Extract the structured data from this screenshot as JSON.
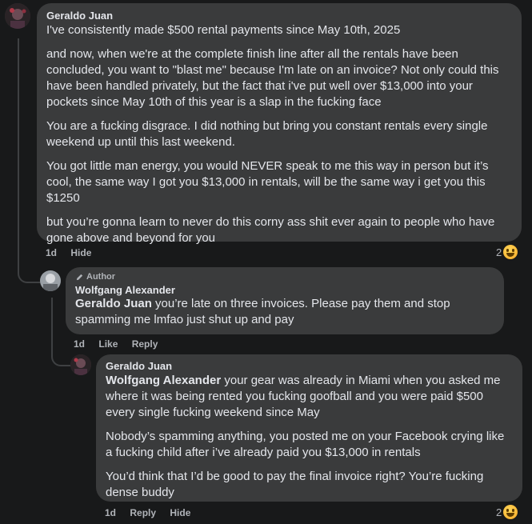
{
  "comment1": {
    "author": "Geraldo Juan",
    "paragraphs": [
      "I've consistently made $500 rental payments since May 10th, 2025",
      "and now, when we're at the complete finish line after all the rentals have been concluded, you want to \"blast me\" because I'm late on an invoice? Not only could this have been handled privately, but the fact that i've put well over $13,000 into your pockets since May 10th of this year is a slap in the fucking face",
      "You are a fucking disgrace. I did nothing but bring you constant rentals every single weekend up until this last weekend.",
      "You got little man energy, you would NEVER speak to me this way in person but it’s cool, the same way I got you $13,000 in rentals, will be the same way i get you this $1250",
      "but you’re gonna learn to never do this corny ass shit ever again to people who have gone above and beyond for you"
    ],
    "time": "1d",
    "hide_label": "Hide",
    "reaction_count": "2",
    "reaction_icon": "laughing-emoji-icon"
  },
  "reply1": {
    "badge": "Author",
    "badge_icon": "pencil-icon",
    "author": "Wolfgang Alexander",
    "mention": "Geraldo Juan",
    "text": " you’re late on three invoices. Please pay them and stop spamming me lmfao just shut up and pay",
    "time": "1d",
    "like_label": "Like",
    "reply_label": "Reply"
  },
  "reply2": {
    "author": "Geraldo Juan",
    "mention": "Wolfgang Alexander",
    "first_text": " your gear was already in Miami when you asked me where it was being rented you fucking goofball and you were paid $500 every single fucking weekend since May",
    "paragraphs": [
      "Nobody’s spamming anything, you posted me on your Facebook crying like a fucking child after i’ve already paid you $13,000 in rentals",
      "You’d think that I’d be good to pay the final invoice right? You’re fucking dense buddy"
    ],
    "time": "1d",
    "reply_label": "Reply",
    "hide_label": "Hide",
    "reaction_count": "2",
    "reaction_icon": "laughing-emoji-icon"
  }
}
